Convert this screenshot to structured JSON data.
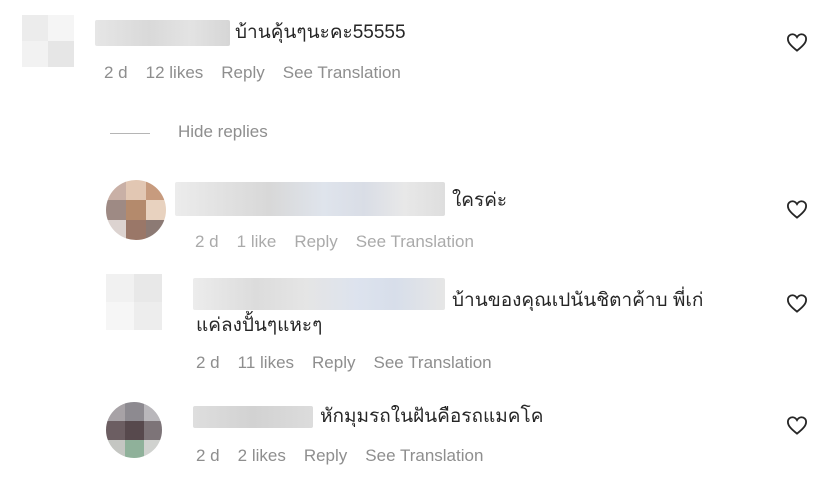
{
  "comments": [
    {
      "text": "บ้านคุ้นๆนะคะ55555",
      "time": "2 d",
      "likes": "12 likes",
      "reply": "Reply",
      "translate": "See Translation"
    }
  ],
  "hide_replies": "Hide replies",
  "replies": [
    {
      "text": "ใครค่ะ",
      "time": "2 d",
      "likes": "1 like",
      "reply": "Reply",
      "translate": "See Translation"
    },
    {
      "text_line1": "บ้านของคุณเปนันชิตาค้าบ พี่เก่",
      "text_line2": "แค่ลงปั้นๆแหะๆ",
      "time": "2 d",
      "likes": "11 likes",
      "reply": "Reply",
      "translate": "See Translation"
    },
    {
      "text": "หักมุมรถในฝันคือรถแมคโค",
      "time": "2 d",
      "likes": "2 likes",
      "reply": "Reply",
      "translate": "See Translation"
    }
  ],
  "icons": {
    "heart": "heart-outline-icon"
  },
  "colors": {
    "text": "#262626",
    "meta": "#8e8e8e"
  }
}
